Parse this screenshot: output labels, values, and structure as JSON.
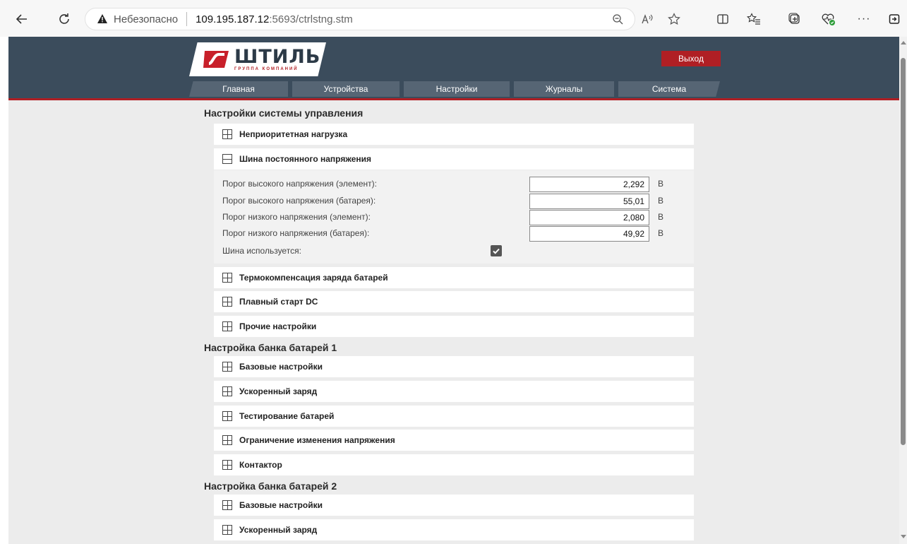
{
  "browser": {
    "back_icon": "arrow-left-icon",
    "reload_icon": "reload-icon",
    "security_label": "Небезопасно",
    "url_host": "109.195.187.12",
    "url_rest": ":5693/ctrlstng.stm"
  },
  "header": {
    "logo_text": "ШТИЛЬ",
    "logo_subtext": "ГРУППА КОМПАНИЙ",
    "logout_label": "Выход",
    "menu": [
      {
        "label": "Главная"
      },
      {
        "label": "Устройства"
      },
      {
        "label": "Настройки"
      },
      {
        "label": "Журналы"
      },
      {
        "label": "Система"
      }
    ]
  },
  "sections": [
    {
      "title": "Настройки системы управления",
      "groups": [
        {
          "label": "Неприоритетная нагрузка",
          "expanded": false
        },
        {
          "label": "Шина постоянного напряжения",
          "expanded": true
        },
        {
          "label": "Термокомпенсация заряда батарей",
          "expanded": false
        },
        {
          "label": "Плавный старт DC",
          "expanded": false
        },
        {
          "label": "Прочие настройки",
          "expanded": false
        }
      ]
    },
    {
      "title": "Настройка банка батарей 1",
      "groups": [
        {
          "label": "Базовые настройки"
        },
        {
          "label": "Ускоренный заряд"
        },
        {
          "label": "Тестирование батарей"
        },
        {
          "label": "Ограничение изменения напряжения"
        },
        {
          "label": "Контактор"
        }
      ]
    },
    {
      "title": "Настройка банка батарей 2",
      "groups": [
        {
          "label": "Базовые настройки"
        },
        {
          "label": "Ускоренный заряд"
        }
      ]
    }
  ],
  "dc_bus": {
    "params": [
      {
        "label": "Порог высокого напряжения (элемент):",
        "value": "2,292",
        "unit": "В"
      },
      {
        "label": "Порог высокого напряжения (батарея):",
        "value": "55,01",
        "unit": "В"
      },
      {
        "label": "Порог низкого напряжения (элемент):",
        "value": "2,080",
        "unit": "В"
      },
      {
        "label": "Порог низкого напряжения (батарея):",
        "value": "49,92",
        "unit": "В"
      }
    ],
    "bus_used_label": "Шина используется:",
    "bus_used": true
  },
  "colors": {
    "header_bg": "#3b4c5c",
    "accent_red": "#b01f24",
    "menu_tab": "#566574",
    "page_bg": "#ececec"
  }
}
